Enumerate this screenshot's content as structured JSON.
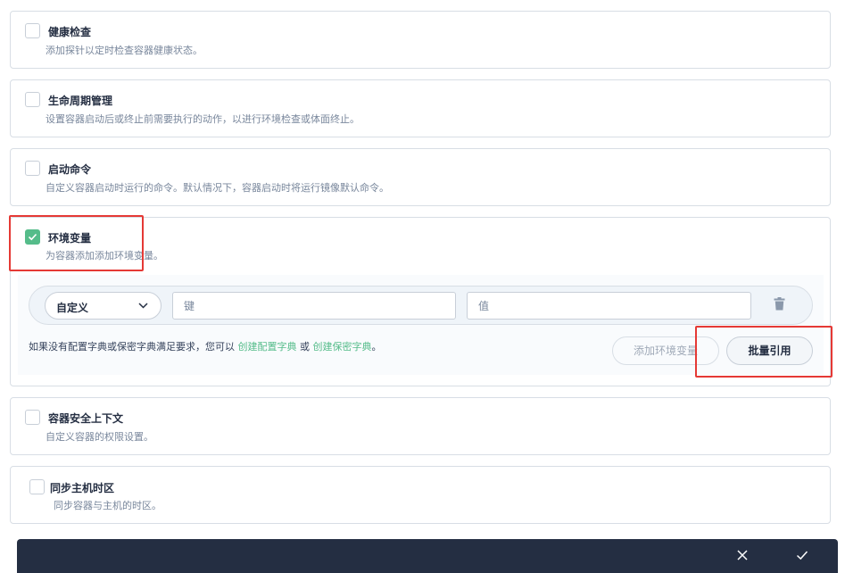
{
  "sections": {
    "health_check": {
      "title": "健康检查",
      "desc": "添加探针以定时检查容器健康状态。",
      "checked": false
    },
    "lifecycle": {
      "title": "生命周期管理",
      "desc": "设置容器启动后或终止前需要执行的动作，以进行环境检查或体面终止。",
      "checked": false
    },
    "start_command": {
      "title": "启动命令",
      "desc": "自定义容器启动时运行的命令。默认情况下，容器启动时将运行镜像默认命令。",
      "checked": false
    },
    "env_vars": {
      "title": "环境变量",
      "desc": "为容器添加添加环境变量。",
      "checked": true,
      "row": {
        "type_value": "自定义",
        "key_placeholder": "键",
        "value_placeholder": "值"
      },
      "hint_prefix": "如果没有配置字典或保密字典满足要求，您可以",
      "link_configmap": "创建配置字典",
      "hint_or": "或",
      "link_secret": "创建保密字典",
      "hint_suffix": "。",
      "add_button": "添加环境变量",
      "batch_button": "批量引用"
    },
    "security_context": {
      "title": "容器安全上下文",
      "desc": "自定义容器的权限设置。",
      "checked": false
    },
    "sync_timezone": {
      "title": "同步主机时区",
      "desc": "同步容器与主机的时区。",
      "checked": false
    }
  },
  "footer": {
    "cancel_icon": "close-icon",
    "confirm_icon": "check-icon"
  },
  "colors": {
    "accent": "#55bc8a",
    "annotation": "#e53935",
    "footer_bg": "#242e42"
  }
}
